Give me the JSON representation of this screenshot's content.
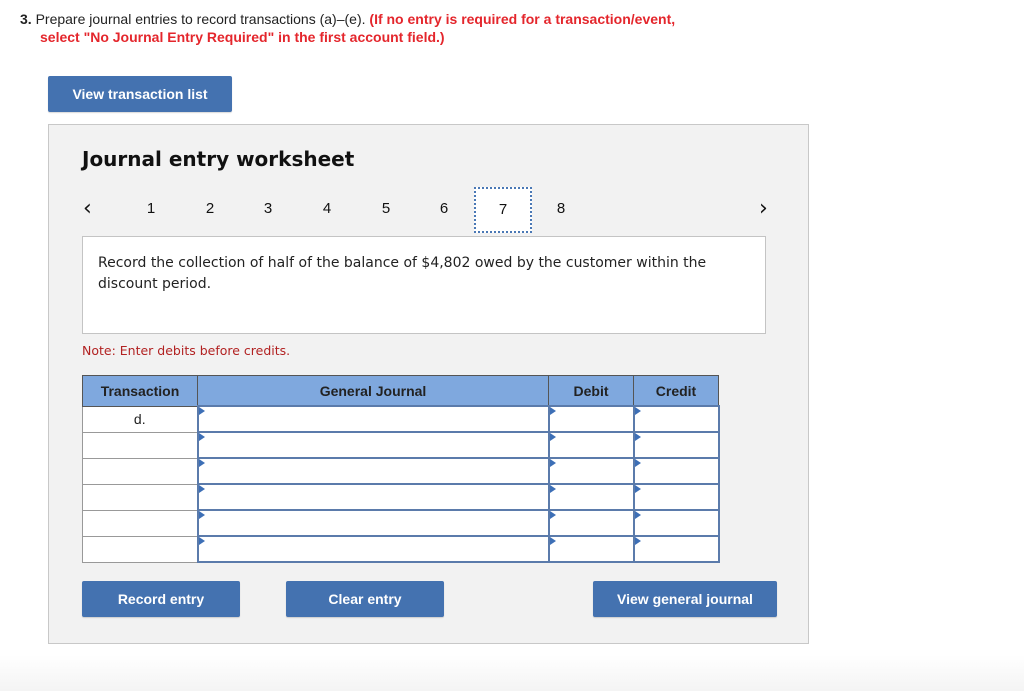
{
  "question": {
    "number": "3.",
    "text": "Prepare journal entries to record transactions (a)–(e).",
    "instruction_line1": "(If no entry is required for a transaction/event,",
    "instruction_line2": "select \"No Journal Entry Required\" in the first account field.)"
  },
  "buttons": {
    "view_transaction_list": "View transaction list",
    "record_entry": "Record entry",
    "clear_entry": "Clear entry",
    "view_general_journal": "View general journal"
  },
  "worksheet": {
    "title": "Journal entry worksheet",
    "pager": {
      "prev_icon": "‹",
      "next_icon": "›",
      "pages": [
        "1",
        "2",
        "3",
        "4",
        "5",
        "6",
        "7",
        "8"
      ],
      "active_page": "7"
    },
    "description": "Record the collection of half of the balance of $4,802 owed by the customer within the discount period.",
    "note": "Note: Enter debits before credits."
  },
  "journal_table": {
    "headers": [
      "Transaction",
      "General Journal",
      "Debit",
      "Credit"
    ],
    "rows": [
      {
        "transaction": "d.",
        "account": "",
        "debit": "",
        "credit": ""
      },
      {
        "transaction": "",
        "account": "",
        "debit": "",
        "credit": ""
      },
      {
        "transaction": "",
        "account": "",
        "debit": "",
        "credit": ""
      },
      {
        "transaction": "",
        "account": "",
        "debit": "",
        "credit": ""
      },
      {
        "transaction": "",
        "account": "",
        "debit": "",
        "credit": ""
      },
      {
        "transaction": "",
        "account": "",
        "debit": "",
        "credit": ""
      }
    ]
  },
  "colors": {
    "button_blue": "#4472b0",
    "header_blue": "#7fa8de",
    "instruction_red": "#e4262c",
    "note_red": "#b22222",
    "cell_border": "#5b7bab"
  }
}
